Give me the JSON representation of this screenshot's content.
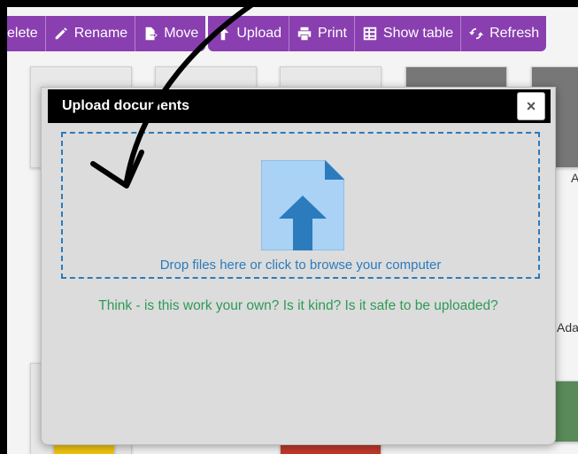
{
  "toolbar": {
    "delete_label": "elete",
    "rename_label": "Rename",
    "move_label": "Move",
    "upload_label": "Upload",
    "print_label": "Print",
    "show_table_label": "Show table",
    "refresh_label": "Refresh",
    "accent_color": "#8a3fb0"
  },
  "modal": {
    "title": "Upload documents",
    "close_symbol": "×",
    "dropzone_text": "Drop files here or click to browse your computer",
    "warning_text": "Think - is this work your own? Is it kind? Is it safe to be uploaded?",
    "dropzone_color": "#2b7bbd",
    "warning_color": "#2e9a57"
  },
  "background": {
    "side_label_1": "Ada",
    "side_label_2": "A"
  }
}
